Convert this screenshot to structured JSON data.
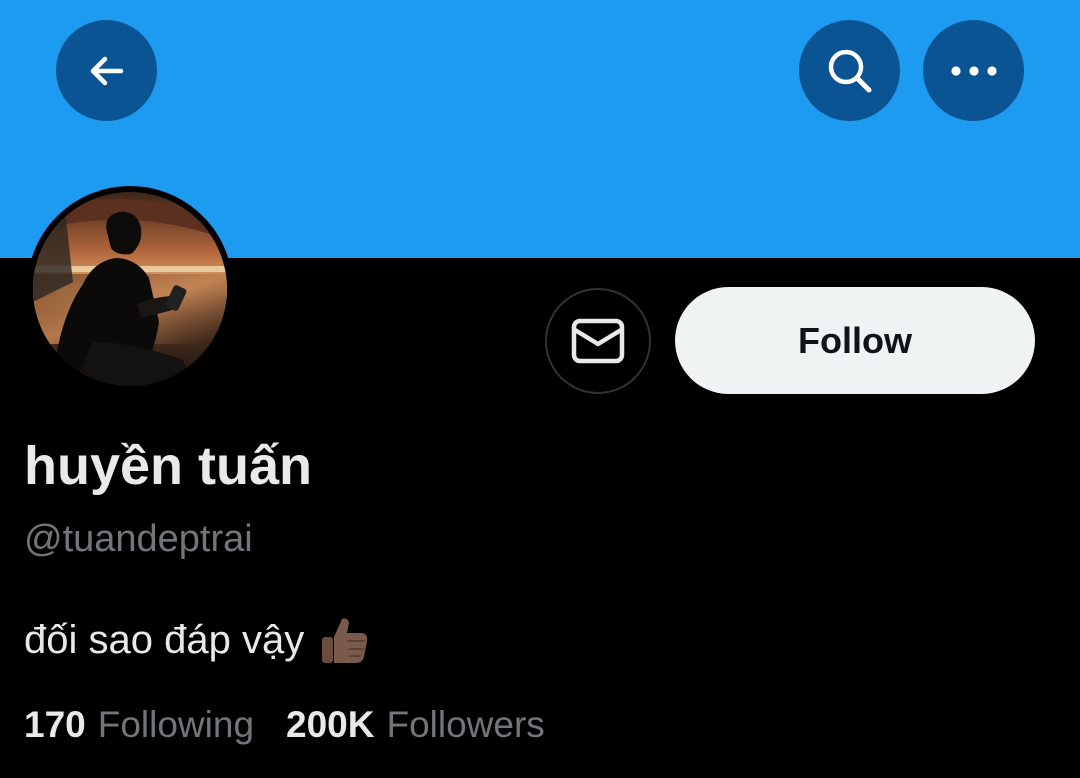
{
  "header": {
    "banner_color": "#1d9bf0",
    "back_icon": "arrow-left-icon",
    "search_icon": "search-icon",
    "more_icon": "more-horizontal-icon"
  },
  "profile": {
    "display_name": "huyền tuấn",
    "handle": "@tuandeptrai",
    "bio": "đối sao đáp vậy",
    "bio_emoji": "thumbs-up-icon",
    "avatar": "avatar-photo"
  },
  "actions": {
    "message_icon": "mail-icon",
    "follow_label": "Follow"
  },
  "stats": {
    "following_count": "170",
    "following_label": "Following",
    "followers_count": "200K",
    "followers_label": "Followers"
  }
}
